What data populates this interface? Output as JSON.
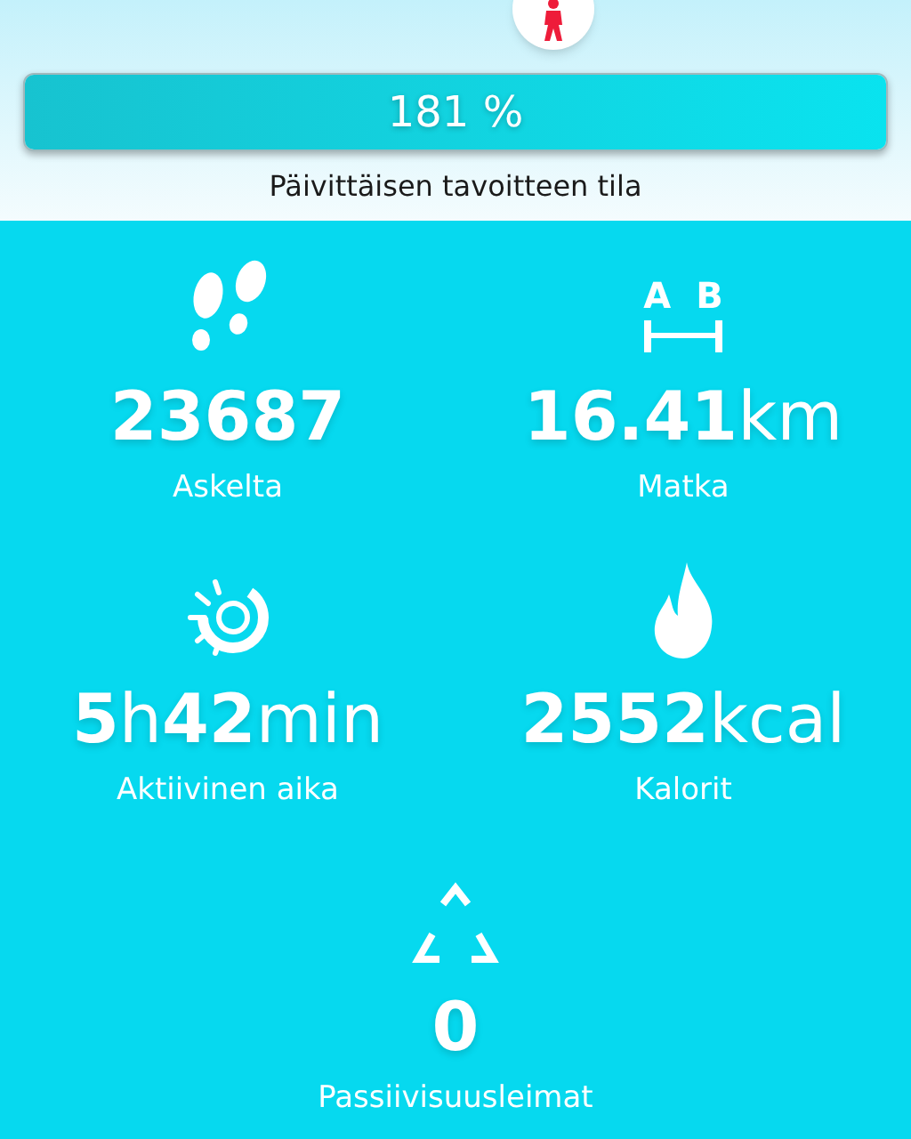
{
  "goal": {
    "percent": "181 %",
    "level": 1,
    "caption": "Päivittäisen tavoitteen tila"
  },
  "stats": [
    {
      "kind": "steps",
      "value": "23687",
      "label": "Askelta"
    },
    {
      "kind": "distance",
      "value": "**16.41**km",
      "label": "Matka",
      "icon_letters": [
        "A",
        "B"
      ]
    },
    {
      "kind": "active",
      "value": "**5**h**42**min",
      "label": "Aktiivinen aika"
    },
    {
      "kind": "calories",
      "value": "**2552**kcal",
      "label": "Kalorit"
    },
    {
      "kind": "inactivity",
      "value": "0",
      "label": "Passiivisuusleimat"
    }
  ]
}
